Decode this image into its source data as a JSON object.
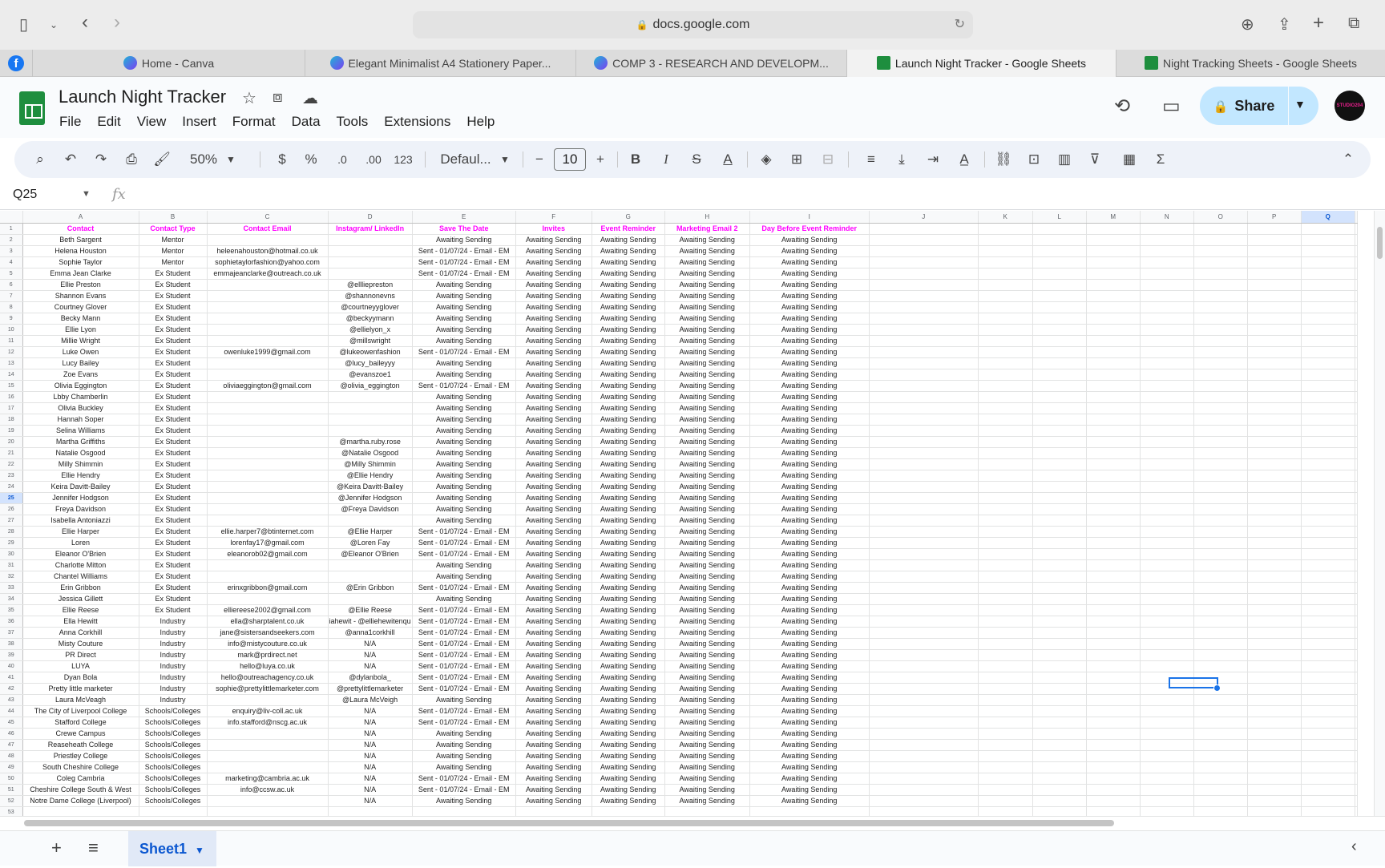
{
  "browser": {
    "url": "docs.google.com",
    "tabs": [
      {
        "label": "Home - Canva",
        "icon": "canva-icon"
      },
      {
        "label": "Elegant Minimalist A4 Stationery Paper...",
        "icon": "canva-icon"
      },
      {
        "label": "COMP 3 - RESEARCH AND DEVELOPM...",
        "icon": "canva-icon"
      },
      {
        "label": "Launch Night Tracker - Google Sheets",
        "icon": "sheets-icon"
      },
      {
        "label": "Night Tracking Sheets - Google Sheets",
        "icon": "sheets-icon"
      }
    ]
  },
  "app": {
    "title": "Launch Night Tracker",
    "menu": [
      "File",
      "Edit",
      "View",
      "Insert",
      "Format",
      "Data",
      "Tools",
      "Extensions",
      "Help"
    ],
    "share_label": "Share",
    "avatar_text": "STUDIO204"
  },
  "toolbar": {
    "zoom": "50%",
    "currency": "$",
    "percent": "%",
    "dec_decrease": ".0",
    "dec_increase": ".00",
    "number_format": "123",
    "font": "Defaul...",
    "font_size": "10"
  },
  "formula": {
    "name_box": "Q25",
    "fx": "fx"
  },
  "grid": {
    "columns": [
      "A",
      "B",
      "C",
      "D",
      "E",
      "F",
      "G",
      "H",
      "I",
      "J",
      "K",
      "L",
      "M",
      "N",
      "O",
      "P",
      "Q"
    ],
    "selected_column": "Q",
    "selected_row": 25,
    "headers": [
      "Contact",
      "Contact Type",
      "Contact Email",
      "Instagram/ LinkedIn",
      "Save The Date",
      "Invites",
      "Event Reminder",
      "Marketing Email 2",
      "Day Before Event Reminder"
    ],
    "rows": [
      [
        "Beth Sargent",
        "Mentor",
        "",
        "",
        "Awaiting Sending"
      ],
      [
        "Helena Houston",
        "Mentor",
        "heleenahouston@hotmail.co.uk",
        "",
        "Sent - 01/07/24 - Email - EM"
      ],
      [
        "Sophie Taylor",
        "Mentor",
        "sophietaylorfashion@yahoo.com",
        "",
        "Sent - 01/07/24 - Email - EM"
      ],
      [
        "Emma Jean Clarke",
        "Ex Student",
        "emmajeanclarke@outreach.co.uk",
        "",
        "Sent - 01/07/24 - Email - EM"
      ],
      [
        "Ellie Preston",
        "Ex Student",
        "",
        "@ellliepreston",
        "Awaiting Sending"
      ],
      [
        "Shannon Evans",
        "Ex Student",
        "",
        "@shannonevns",
        "Awaiting Sending"
      ],
      [
        "Courtney Glover",
        "Ex Student",
        "",
        "@courtneyyglover",
        "Awaiting Sending"
      ],
      [
        "Becky Mann",
        "Ex Student",
        "",
        "@beckyymann",
        "Awaiting Sending"
      ],
      [
        "Ellie Lyon",
        "Ex Student",
        "",
        "@ellielyon_x",
        "Awaiting Sending"
      ],
      [
        "Millie Wright",
        "Ex Student",
        "",
        "@millswright",
        "Awaiting Sending"
      ],
      [
        "Luke Owen",
        "Ex Student",
        "owenluke1999@gmail.com",
        "@lukeowenfashion",
        "Sent - 01/07/24 - Email - EM"
      ],
      [
        "Lucy Bailey",
        "Ex Student",
        "",
        "@lucy_baileyyy",
        "Awaiting Sending"
      ],
      [
        "Zoe Evans",
        "Ex Student",
        "",
        "@evanszoe1",
        "Awaiting Sending"
      ],
      [
        "Olivia Eggington",
        "Ex Student",
        "oliviaeggington@gmail.com",
        "@olivia_eggington",
        "Sent - 01/07/24 - Email - EM"
      ],
      [
        "Lbby Chamberlin",
        "Ex Student",
        "",
        "",
        "Awaiting Sending"
      ],
      [
        "Olivia Buckley",
        "Ex Student",
        "",
        "",
        "Awaiting Sending"
      ],
      [
        "Hannah Soper",
        "Ex Student",
        "",
        "",
        "Awaiting Sending"
      ],
      [
        "Selina Williams",
        "Ex Student",
        "",
        "",
        "Awaiting Sending"
      ],
      [
        "Martha Griffiths",
        "Ex Student",
        "",
        "@martha.ruby.rose",
        "Awaiting Sending"
      ],
      [
        "Natalie Osgood",
        "Ex Student",
        "",
        "@Natalie Osgood",
        "Awaiting Sending"
      ],
      [
        "Milly Shimmin",
        "Ex Student",
        "",
        "@Milly Shimmin",
        "Awaiting Sending"
      ],
      [
        "Ellie Hendry",
        "Ex Student",
        "",
        "@Ellie Hendry",
        "Awaiting Sending"
      ],
      [
        "Keira Davitt-Bailey",
        "Ex Student",
        "",
        "@Keira Davitt-Bailey",
        "Awaiting Sending"
      ],
      [
        "Jennifer Hodgson",
        "Ex Student",
        "",
        "@Jennifer Hodgson",
        "Awaiting Sending"
      ],
      [
        "Freya Davidson",
        "Ex Student",
        "",
        "@Freya Davidson",
        "Awaiting Sending"
      ],
      [
        "Isabella Antoniazzi",
        "Ex Student",
        "",
        "",
        "Awaiting Sending"
      ],
      [
        "Ellie Harper",
        "Ex Student",
        "ellie.harper7@btinternet.com",
        "@Ellie Harper",
        "Sent - 01/07/24 - Email - EM"
      ],
      [
        "Loren",
        "Ex Student",
        "lorenfay17@gmail.com",
        "@Loren Fay",
        "Sent - 01/07/24 - Email - EM"
      ],
      [
        "Eleanor O'Brien",
        "Ex Student",
        "eleanorob02@gmail.com",
        "@Eleanor O'Brien",
        "Sent - 01/07/24 - Email - EM"
      ],
      [
        "Charlotte Mitton",
        "Ex Student",
        "",
        "",
        "Awaiting Sending"
      ],
      [
        "Chantel Williams",
        "Ex Student",
        "",
        "",
        "Awaiting Sending"
      ],
      [
        "Erin Gribbon",
        "Ex Student",
        "erinxgribbon@gmail.com",
        "@Erin Gribbon",
        "Sent - 01/07/24 - Email - EM"
      ],
      [
        "Jessica Gillett",
        "Ex Student",
        "",
        "",
        "Awaiting Sending"
      ],
      [
        "Ellie Reese",
        "Ex Student",
        "elliereese2002@gmail.com",
        "@Ellie Reese",
        "Sent - 01/07/24 - Email - EM"
      ],
      [
        "Ella Hewitt",
        "Industry",
        "ella@sharptalent.co.uk",
        "iahewit - @elliehewitenqu",
        "Sent - 01/07/24 - Email - EM"
      ],
      [
        "Anna Corkhill",
        "Industry",
        "jane@sistersandseekers.com",
        "@anna1corkhill",
        "Sent - 01/07/24 - Email - EM"
      ],
      [
        "Misty Couture",
        "Industry",
        "info@mistycouture.co.uk",
        "N/A",
        "Sent - 01/07/24 - Email - EM"
      ],
      [
        "PR Direct",
        "Industry",
        "mark@prdirect.net",
        "N/A",
        "Sent - 01/07/24 - Email - EM"
      ],
      [
        "LUYA",
        "Industry",
        "hello@luya.co.uk",
        "N/A",
        "Sent - 01/07/24 - Email - EM"
      ],
      [
        "Dyan Bola",
        "Industry",
        "hello@outreachagency.co.uk",
        "@dylanbola_",
        "Sent - 01/07/24 - Email - EM"
      ],
      [
        "Pretty little marketer",
        "Industry",
        "sophie@prettylittlemarketer.com",
        "@prettylittlemarketer",
        "Sent - 01/07/24 - Email - EM"
      ],
      [
        "Laura McVeagh",
        "Industry",
        "",
        "@Laura McVeigh",
        "Awaiting Sending"
      ],
      [
        "The City of Liverpool College",
        "Schools/Colleges",
        "enquiry@liv-coll.ac.uk",
        "N/A",
        "Sent - 01/07/24 - Email - EM"
      ],
      [
        "Stafford College",
        "Schools/Colleges",
        "info.stafford@nscg.ac.uk",
        "N/A",
        "Sent - 01/07/24 - Email - EM"
      ],
      [
        "Crewe Campus",
        "Schools/Colleges",
        "",
        "N/A",
        "Awaiting Sending"
      ],
      [
        "Reaseheath College",
        "Schools/Colleges",
        "",
        "N/A",
        "Awaiting Sending"
      ],
      [
        "Priestley College",
        "Schools/Colleges",
        "",
        "N/A",
        "Awaiting Sending"
      ],
      [
        "South Cheshire College",
        "Schools/Colleges",
        "",
        "N/A",
        "Awaiting Sending"
      ],
      [
        "Coleg Cambria",
        "Schools/Colleges",
        "marketing@cambria.ac.uk",
        "N/A",
        "Sent - 01/07/24 - Email - EM"
      ],
      [
        "Cheshire College South & West",
        "Schools/Colleges",
        "info@ccsw.ac.uk",
        "N/A",
        "Sent - 01/07/24 - Email - EM"
      ],
      [
        "Notre Dame College (Liverpool)",
        "Schools/Colleges",
        "",
        "N/A",
        "Awaiting Sending"
      ]
    ],
    "fill_status": "Awaiting Sending"
  },
  "bottom": {
    "sheet_tab": "Sheet1"
  }
}
